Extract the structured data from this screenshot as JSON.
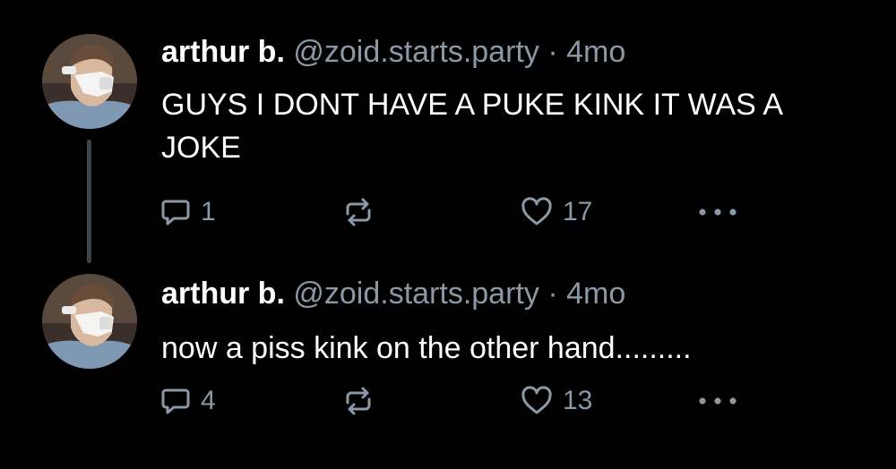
{
  "posts": [
    {
      "author": {
        "display_name": "arthur b.",
        "handle": "@zoid.starts.party",
        "separator": "·",
        "time": "4mo"
      },
      "text": "GUYS I DONT HAVE A PUKE KINK IT WAS A JOKE",
      "stats": {
        "replies": "1",
        "reposts": "",
        "likes": "17"
      }
    },
    {
      "author": {
        "display_name": "arthur b.",
        "handle": "@zoid.starts.party",
        "separator": "·",
        "time": "4mo"
      },
      "text": "now a piss kink on the other hand.........",
      "stats": {
        "replies": "4",
        "reposts": "",
        "likes": "13"
      }
    }
  ],
  "icons": {
    "reply": "speech-bubble-icon",
    "repost": "repost-arrows-icon",
    "like": "heart-icon",
    "more": "ellipsis-icon"
  },
  "colors": {
    "background": "#000000",
    "text_primary": "#ffffff",
    "text_secondary": "#8b98a5",
    "thread_line": "#3b444e"
  }
}
